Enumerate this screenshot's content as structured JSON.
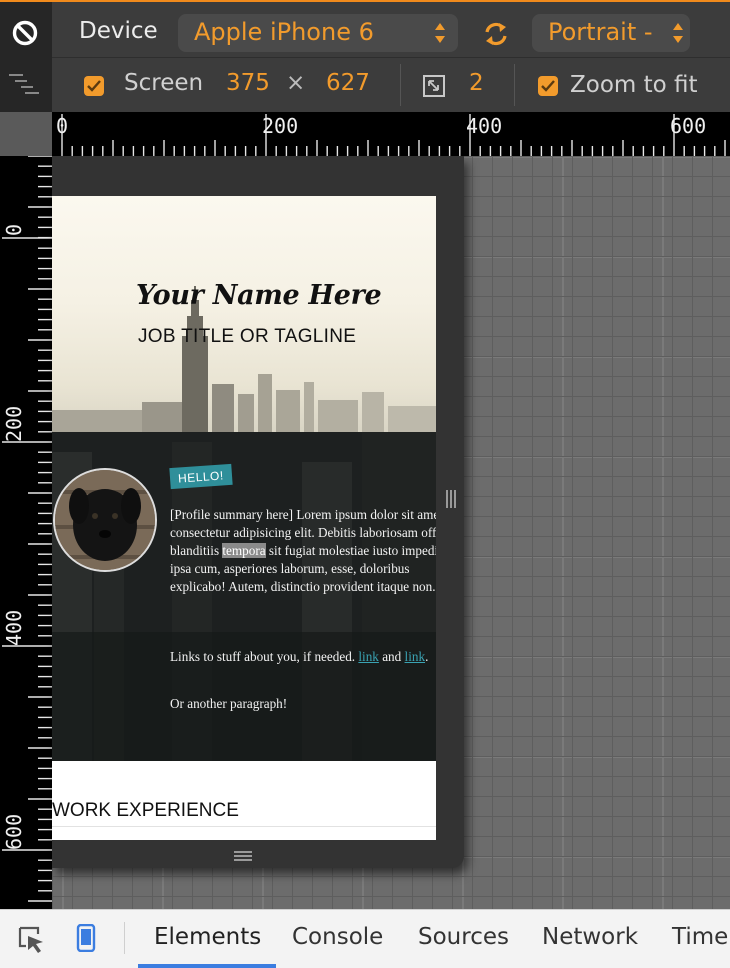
{
  "toolbar": {
    "device_label": "Device",
    "device_value": "Apple iPhone 6",
    "orientation_value": "Portrait -",
    "screen_label": "Screen",
    "screen_width": "375",
    "times_sign": "×",
    "screen_height": "627",
    "pixel_ratio": "2",
    "zoom_label": "Zoom to fit",
    "screen_checked": true,
    "zoom_checked": true
  },
  "rulers": {
    "horizontal": [
      "0",
      "200",
      "400",
      "600"
    ],
    "vertical": [
      "0",
      "200",
      "400",
      "600"
    ]
  },
  "page": {
    "name": "Your Name Here",
    "tagline": "JOB TITLE OR TAGLINE",
    "hello_badge": "HELLO!",
    "summary_before": "[Profile summary here] Lorem ipsum dolor sit amet, consectetur adipisicing elit. Debitis laboriosam officia blanditiis ",
    "summary_highlight": "tempora",
    "summary_after": " sit fugiat molestiae iusto impedit ipsa cum, asperiores laborum, esse, doloribus explicabo! Autem, distinctio provident itaque non.",
    "links_text_before": "Links to stuff about you, if needed. ",
    "link1": "link",
    "links_text_mid": " and ",
    "link2": "link",
    "links_text_after": ".",
    "another_paragraph": "Or another paragraph!",
    "section_heading": "WORK EXPERIENCE"
  },
  "tabs": [
    "Elements",
    "Console",
    "Sources",
    "Network",
    "Time"
  ],
  "active_tab": "Elements",
  "colors": {
    "accent": "#f29b2c",
    "active_tab_underline": "#3b7de0",
    "hello_badge": "#2f8f9a",
    "link": "#3aa3b3"
  }
}
